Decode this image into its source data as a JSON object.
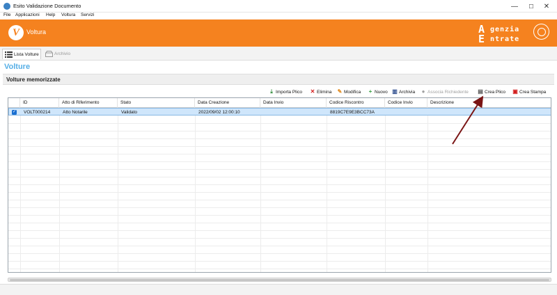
{
  "window": {
    "title": "Esito Validazione Documento",
    "minimize": "—",
    "maximize": "☐",
    "close": "✕"
  },
  "menu": [
    "File",
    "Applicazioni",
    "Help",
    "Voltura",
    "Servizi"
  ],
  "header": {
    "app_logo": "V",
    "app_name": "Voltura",
    "brand_line1_initial": "A",
    "brand_line1_rest": "genzia",
    "brand_line2_initial": "E",
    "brand_line2_rest": "ntrate",
    "accent_color": "#f5821f"
  },
  "tabs": [
    {
      "label": "Lista Volture",
      "icon": "list-icon",
      "active": true
    },
    {
      "label": "Archivio",
      "icon": "archive-icon",
      "active": false
    }
  ],
  "page": {
    "section_title": "Volture",
    "subheading": "Volture memorizzate"
  },
  "toolbar": {
    "import": "Importa Plico",
    "delete": "Elimina",
    "edit": "Modifica",
    "new": "Nuovo",
    "archive": "Archivia",
    "associate": "Associa Richiedente",
    "create_package": "Crea Plico",
    "create_print": "Crea Stampa"
  },
  "table": {
    "columns": [
      "ID",
      "Atto di Riferimento",
      "Stato",
      "Data Creazione",
      "Data Invio",
      "Codice Riscontro",
      "Codice Invio",
      "Descrizione"
    ],
    "rows": [
      {
        "checked": true,
        "id": "VOLT000214",
        "atto": "Atto Notarile",
        "stato": "Validato",
        "data_creazione": "2022/09/02 12:00:10",
        "data_invio": "",
        "codice_riscontro": "8819C7E9E3BCC73A",
        "codice_invio": "",
        "descrizione": ""
      }
    ]
  }
}
